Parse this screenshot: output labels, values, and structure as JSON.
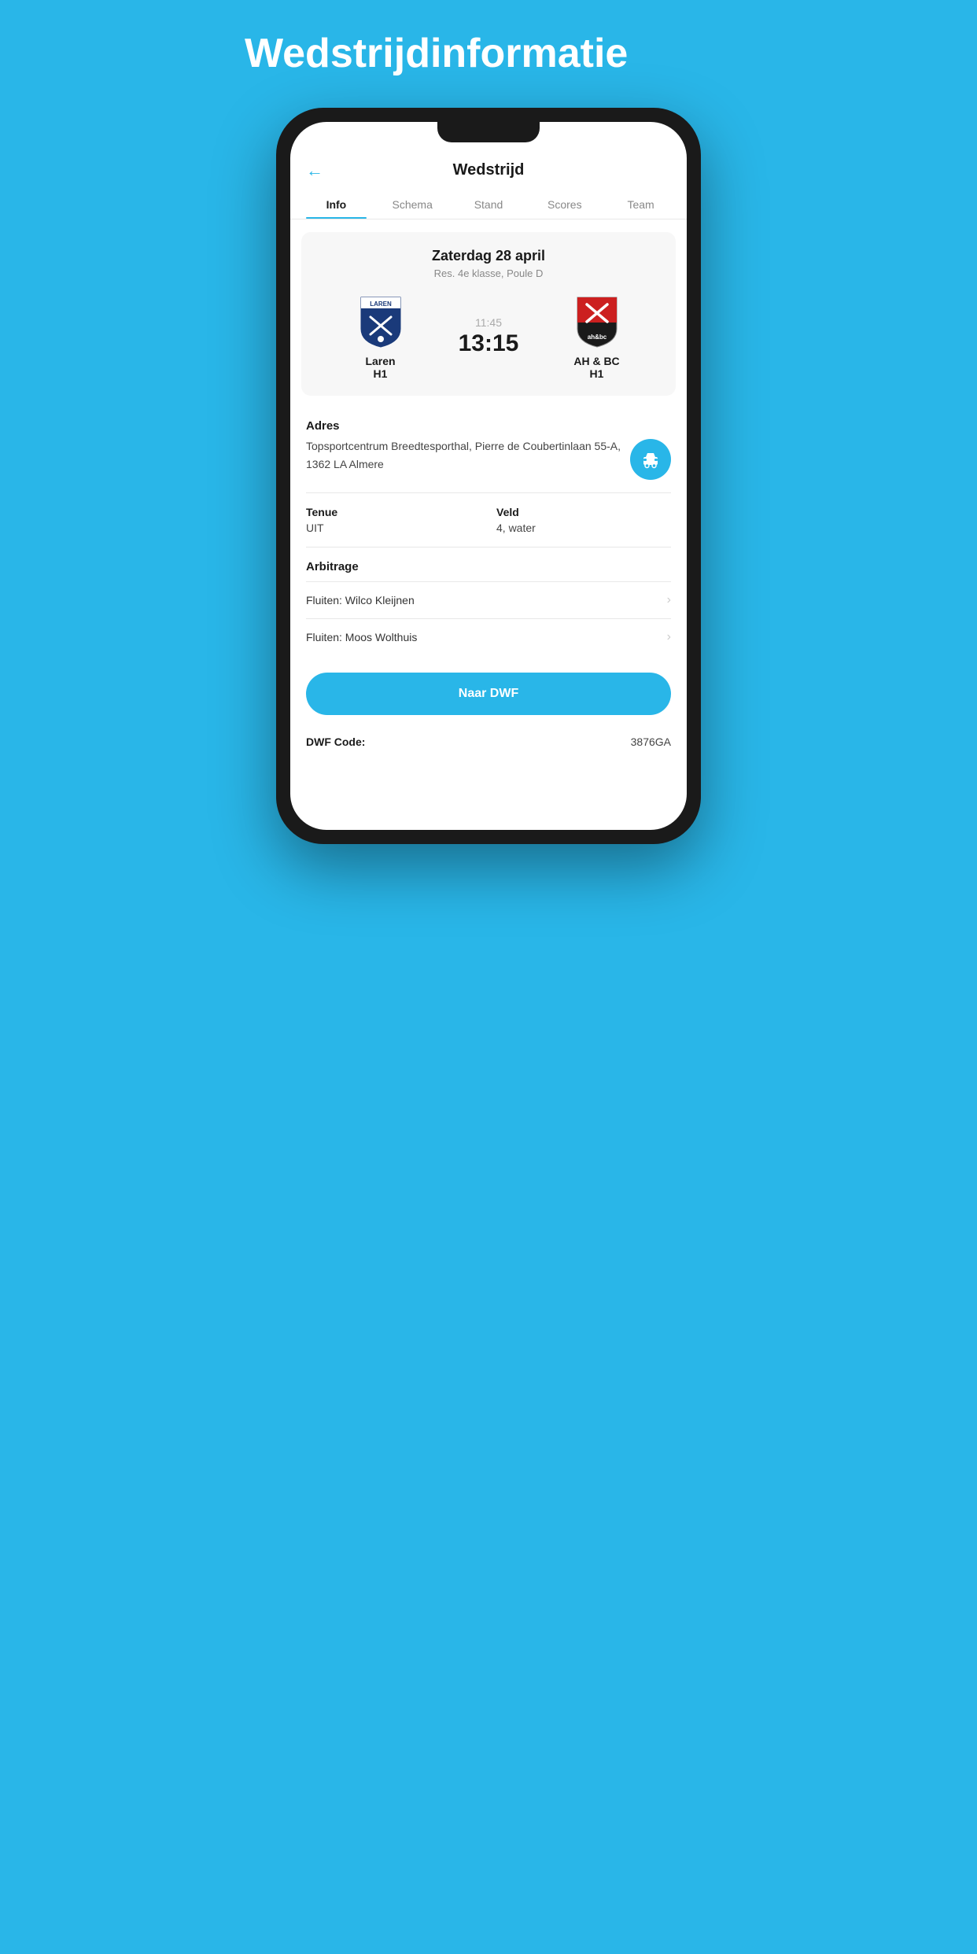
{
  "page": {
    "background_title": "Wedstrijdinformatie",
    "header": {
      "back_label": "←",
      "title": "Wedstrijd"
    },
    "tabs": [
      {
        "id": "info",
        "label": "Info",
        "active": true
      },
      {
        "id": "schema",
        "label": "Schema",
        "active": false
      },
      {
        "id": "stand",
        "label": "Stand",
        "active": false
      },
      {
        "id": "scores",
        "label": "Scores",
        "active": false
      },
      {
        "id": "team",
        "label": "Team",
        "active": false
      }
    ],
    "match": {
      "date": "Zaterdag 28 april",
      "league": "Res. 4e klasse, Poule D",
      "home_team": "Laren",
      "home_class": "H1",
      "away_team": "AH & BC",
      "away_class": "H1",
      "time": "11:45",
      "score": "13:15"
    },
    "address": {
      "label": "Adres",
      "text": "Topsportcentrum Breedtesporthal, Pierre de Coubertinlaan 55-A, 1362 LA Almere",
      "car_icon": "🚗"
    },
    "tenue": {
      "label": "Tenue",
      "value": "UIT"
    },
    "veld": {
      "label": "Veld",
      "value": "4, water"
    },
    "arbitrage": {
      "label": "Arbitrage",
      "items": [
        {
          "text": "Fluiten: Wilco Kleijnen"
        },
        {
          "text": "Fluiten: Moos Wolthuis"
        }
      ]
    },
    "dwf_button_label": "Naar DWF",
    "dwf_code_label": "DWF Code:",
    "dwf_code_value": "3876GA",
    "colors": {
      "accent": "#29b6e8"
    }
  }
}
